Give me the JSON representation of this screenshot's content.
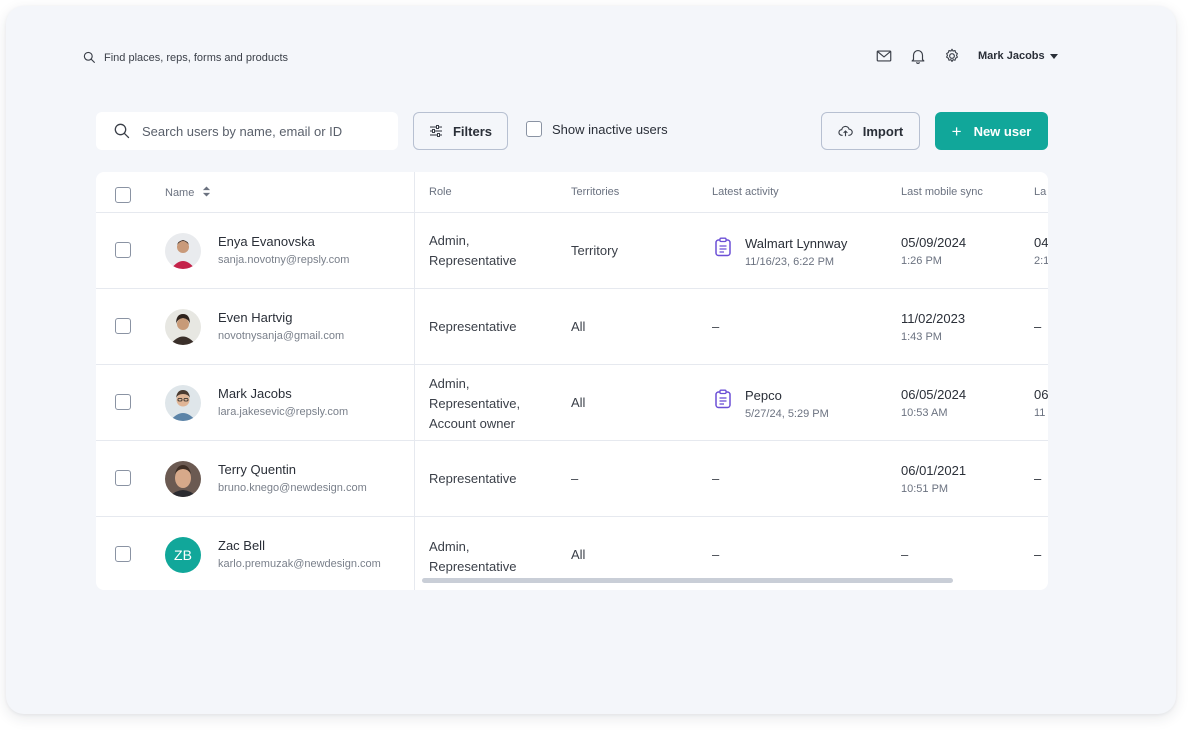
{
  "topbar": {
    "search_placeholder": "Find places, reps, forms and products",
    "user_name": "Mark Jacobs"
  },
  "toolbar": {
    "search_placeholder": "Search users by name, email or ID",
    "filters_label": "Filters",
    "show_inactive_label": "Show inactive users",
    "import_label": "Import",
    "new_user_plus": "+",
    "new_user_label": "New user"
  },
  "table": {
    "columns": {
      "name": "Name",
      "role": "Role",
      "territories": "Territories",
      "latest_activity": "Latest activity",
      "last_mobile_sync": "Last mobile sync",
      "last_cut": "La"
    },
    "rows": [
      {
        "name": "Enya Evanovska",
        "email": "sanja.novotny@repsly.com",
        "role_lines": [
          "Admin,",
          "Representative"
        ],
        "territory": "Territory",
        "activity_title": "Walmart Lynnway",
        "activity_time": "11/16/23, 6:22 PM",
        "sync_date": "05/09/2024",
        "sync_time": "1:26 PM",
        "last_a": "04",
        "last_b": "2:1"
      },
      {
        "name": "Even Hartvig",
        "email": "novotnysanja@gmail.com",
        "role_lines": [
          "Representative"
        ],
        "territory": "All",
        "activity_dash": "–",
        "sync_date": "11/02/2023",
        "sync_time": "1:43 PM",
        "last_a": "–"
      },
      {
        "name": "Mark Jacobs",
        "email": "lara.jakesevic@repsly.com",
        "role_lines": [
          "Admin,",
          "Representative,",
          "Account owner"
        ],
        "territory": "All",
        "activity_title": "Pepco",
        "activity_time": "5/27/24, 5:29 PM",
        "sync_date": "06/05/2024",
        "sync_time": "10:53 AM",
        "last_a": "06",
        "last_b": "11"
      },
      {
        "name": "Terry Quentin",
        "email": "bruno.knego@newdesign.com",
        "role_lines": [
          "Representative"
        ],
        "territory": "–",
        "activity_dash": "–",
        "sync_date": "06/01/2021",
        "sync_time": "10:51 PM",
        "last_a": "–"
      },
      {
        "name": "Zac Bell",
        "email": "karlo.premuzak@newdesign.com",
        "initials": "ZB",
        "role_lines": [
          "Admin,",
          "Representative"
        ],
        "territory": "All",
        "activity_dash": "–",
        "sync_dash": "–",
        "last_a": "–"
      }
    ]
  },
  "colors": {
    "accent": "#11a79a",
    "background": "#f4f6fa",
    "activity_icon": "#6b4fd6"
  },
  "icons": {
    "search": "search-icon",
    "mail": "mail-icon",
    "bell": "bell-icon",
    "gear": "gear-icon",
    "filters": "sliders-icon",
    "import": "cloud-upload-icon",
    "activity": "clipboard-icon",
    "sort": "sort-icon"
  }
}
